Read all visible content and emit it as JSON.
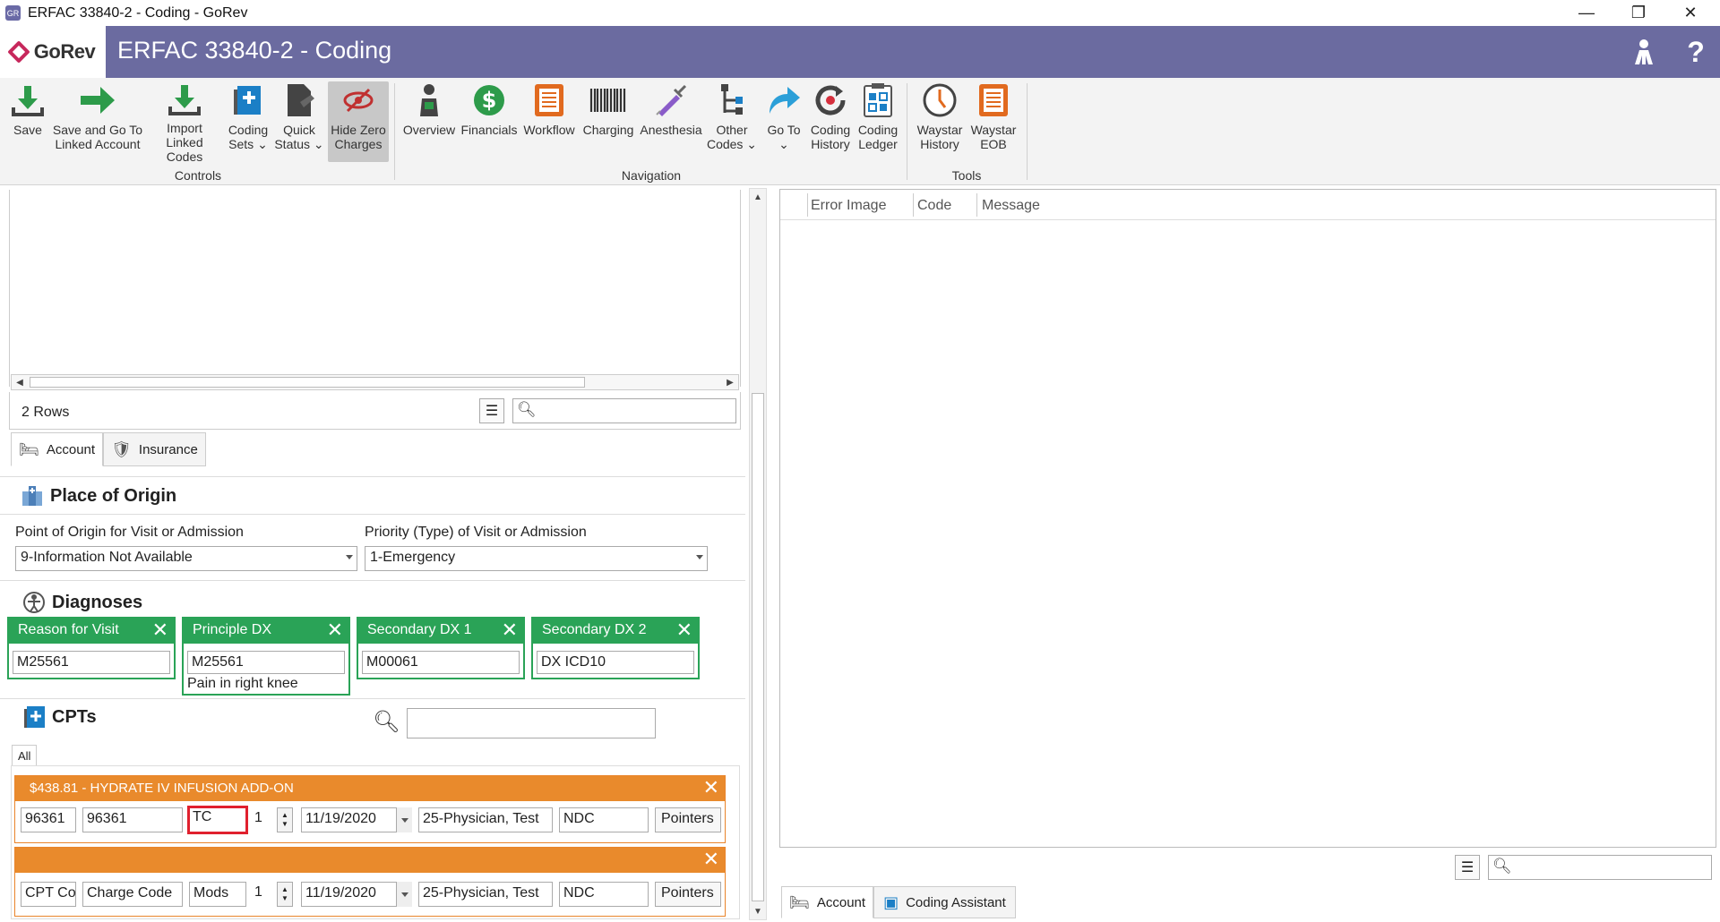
{
  "window": {
    "title": "ERFAC 33840-2 - Coding - GoRev",
    "app_icon": "GR",
    "minimize": "—",
    "restore": "❐",
    "close": "✕"
  },
  "header": {
    "logo_text": "GoRev",
    "doc_title": "ERFAC 33840-2 - Coding",
    "user_icon": "person-key-icon",
    "help": "?"
  },
  "ribbon": {
    "buttons": [
      {
        "label": "Save",
        "label2": "",
        "icon": "download-icon"
      },
      {
        "label": "Save and Go To",
        "label2": "Linked Account",
        "icon": "arrow-right-icon"
      },
      {
        "label": "Import",
        "label2": "Linked Codes",
        "icon": "import-icon"
      },
      {
        "label": "Coding",
        "label2": "Sets ⌄",
        "icon": "coding-sets-icon"
      },
      {
        "label": "Quick",
        "label2": "Status ⌄",
        "icon": "quick-status-icon"
      },
      {
        "label": "Hide Zero",
        "label2": "Charges",
        "icon": "hide-eye-icon"
      },
      {
        "label": "Overview",
        "label2": "",
        "icon": "person-icon"
      },
      {
        "label": "Financials",
        "label2": "",
        "icon": "dollar-icon"
      },
      {
        "label": "Workflow",
        "label2": "",
        "icon": "list-icon"
      },
      {
        "label": "Charging",
        "label2": "",
        "icon": "barcode-icon"
      },
      {
        "label": "Anesthesia",
        "label2": "",
        "icon": "syringe-icon"
      },
      {
        "label": "Other",
        "label2": "Codes ⌄",
        "icon": "tree-icon"
      },
      {
        "label": "Go To",
        "label2": "⌄",
        "icon": "share-arrow-icon"
      },
      {
        "label": "Coding",
        "label2": "History",
        "icon": "history-icon"
      },
      {
        "label": "Coding",
        "label2": "Ledger",
        "icon": "ledger-icon"
      },
      {
        "label": "Waystar",
        "label2": "History",
        "icon": "clock-icon"
      },
      {
        "label": "Waystar",
        "label2": "EOB",
        "icon": "eob-icon"
      }
    ],
    "groups": {
      "controls": "Controls",
      "navigation": "Navigation",
      "tools": "Tools"
    }
  },
  "grid": {
    "rows_label": "2 Rows",
    "search_value": ""
  },
  "left_tabs": [
    "Account",
    "Insurance"
  ],
  "place_of_origin": {
    "title": "Place of Origin",
    "origin_label": "Point of Origin for Visit or Admission",
    "origin_value": "9-Information Not Available",
    "priority_label": "Priority (Type) of Visit or Admission",
    "priority_value": "1-Emergency"
  },
  "diagnoses": {
    "title": "Diagnoses",
    "cards": [
      {
        "title": "Reason for Visit",
        "code": "M25561",
        "desc": ""
      },
      {
        "title": "Principle DX",
        "code": "M25561",
        "desc": "Pain in right knee"
      },
      {
        "title": "Secondary DX 1",
        "code": "M00061",
        "desc": ""
      },
      {
        "title": "Secondary DX 2",
        "code": "DX ICD10",
        "desc": ""
      }
    ]
  },
  "cpts": {
    "title": "CPTs",
    "search_value": "",
    "filter_tab": "All",
    "rows": [
      {
        "header": "$438.81 - HYDRATE IV INFUSION ADD-ON",
        "cpt": "96361",
        "charge": "96361",
        "mods": "TC",
        "qty": "1",
        "date": "11/19/2020",
        "provider": "25-Physician, Test",
        "ndc": "NDC",
        "pointers": "Pointers"
      },
      {
        "header": "",
        "cpt": "CPT Co(",
        "charge": "Charge Code",
        "mods": "Mods",
        "qty": "1",
        "date": "11/19/2020",
        "provider": "25-Physician, Test",
        "ndc": "NDC",
        "pointers": "Pointers"
      }
    ]
  },
  "errors": {
    "columns": [
      "Error Image",
      "Code",
      "Message"
    ],
    "search_value": ""
  },
  "right_tabs": [
    "Account",
    "Coding Assistant"
  ],
  "colors": {
    "header": "#6b6ba0",
    "dx_green": "#2aa357",
    "cpt_orange": "#e98a2c",
    "highlight": "#e0202e"
  }
}
